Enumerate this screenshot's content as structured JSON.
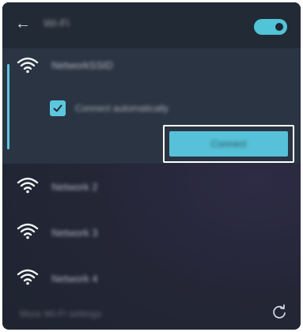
{
  "header": {
    "back_glyph": "←",
    "title": "Wi-Fi",
    "toggle": {
      "state": "on",
      "color": "#52c4d8"
    }
  },
  "networks": [
    {
      "ssid": "NetworkSSID",
      "signal": "full",
      "selected": true,
      "option_label": "Connect automatically",
      "option_checked": true,
      "action_label": "Connect"
    },
    {
      "ssid": "Network 2",
      "signal": "full"
    },
    {
      "ssid": "Network 3",
      "signal": "full"
    },
    {
      "ssid": "Network 4",
      "signal": "full"
    }
  ],
  "footer": {
    "text": "More Wi-Fi settings"
  },
  "icons": {
    "back": "arrow-left-icon",
    "wifi": "wifi-icon",
    "refresh": "refresh-icon",
    "check": "checkmark-icon"
  },
  "colors": {
    "accent": "#5ec7e0",
    "panel": "#242636",
    "selected_row": "#2a3442"
  }
}
